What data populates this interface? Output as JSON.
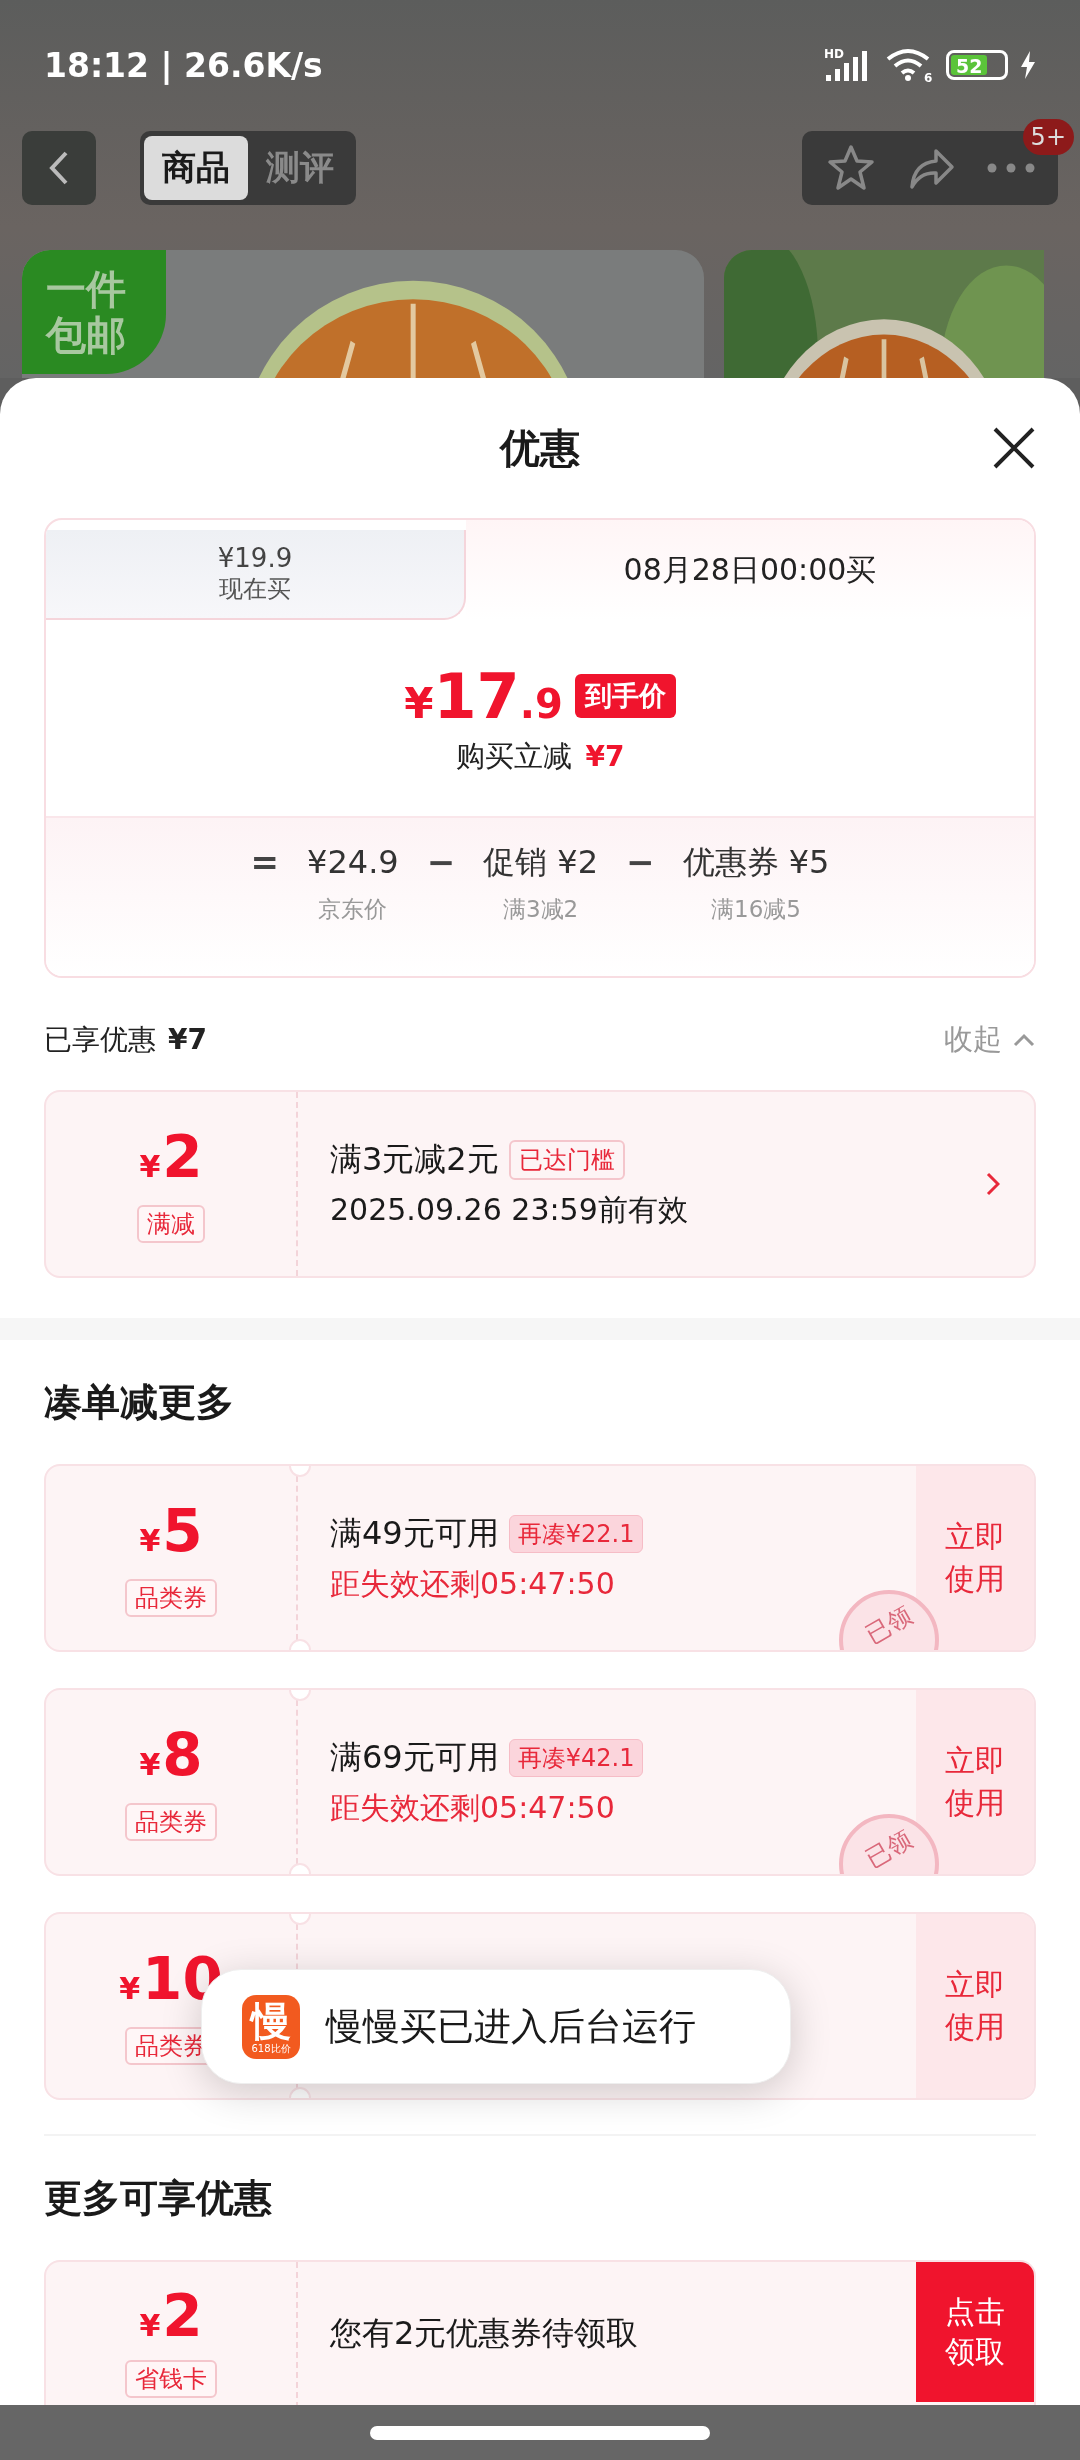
{
  "status_bar": {
    "time": "18:12 | 26.6K/s",
    "signal_label": "HD",
    "wifi_label": "6",
    "battery": "52"
  },
  "nav": {
    "tabs": [
      {
        "label": "商品",
        "selected": true
      },
      {
        "label": "测评",
        "selected": false
      }
    ],
    "badge": "5+"
  },
  "product_banner": {
    "badge_lines": [
      "一件",
      "包邮"
    ]
  },
  "sheet": {
    "title": "优惠"
  },
  "price_tabs": [
    {
      "price": "¥19.9",
      "label": "现在买",
      "selected": false
    },
    {
      "label": "08月28日00:00买",
      "selected": true
    }
  ],
  "final_price": {
    "currency": "¥",
    "integer": "17",
    "decimal": ".9",
    "tag": "到手价",
    "saving_label": "购买立减",
    "saving": "¥7"
  },
  "breakdown": [
    {
      "symbol": "=",
      "value": "¥24.9",
      "note": "京东价"
    },
    {
      "symbol": "−",
      "value": "促销 ¥2",
      "note": "满3减2"
    },
    {
      "symbol": "−",
      "value": "优惠券 ¥5",
      "note": "满16减5"
    }
  ],
  "applied": {
    "title": "已享优惠",
    "amount": "¥7",
    "toggle": "收起",
    "expanded": true
  },
  "applied_coupons": [
    {
      "currency": "¥",
      "amount": "2",
      "type": "满减",
      "condition": "满3元减2元",
      "tag": "已达门槛",
      "validity": "2025.09.26 23:59前有效"
    }
  ],
  "more_section": {
    "title": "凑单减更多"
  },
  "coupons": [
    {
      "currency": "¥",
      "amount": "5",
      "type": "品类券",
      "condition": "满49元可用",
      "tag": "再凑¥22.1",
      "countdown": "距失效还剩05:47:50",
      "stamp": "已领",
      "action": "立即使用"
    },
    {
      "currency": "¥",
      "amount": "8",
      "type": "品类券",
      "condition": "满69元可用",
      "tag": "再凑¥42.1",
      "countdown": "距失效还剩05:47:50",
      "stamp": "已领",
      "action": "立即使用"
    },
    {
      "currency": "¥",
      "amount": "10",
      "type": "品类券",
      "action": "立即使用"
    }
  ],
  "toast": {
    "text": "慢慢买已进入后台运行",
    "icon_char": "慢",
    "icon_sub": "618比价"
  },
  "extra_section": {
    "title": "更多可享优惠"
  },
  "extra_offers": [
    {
      "currency": "¥",
      "amount": "2",
      "type": "省钱卡",
      "text": "您有2元优惠券待领取",
      "action": "点击领取"
    }
  ]
}
